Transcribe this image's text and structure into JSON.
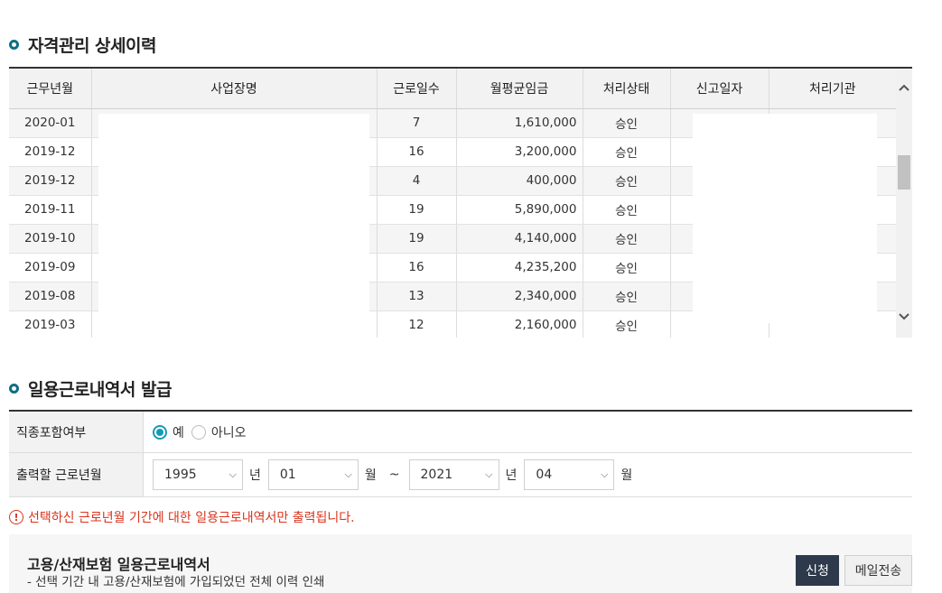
{
  "history": {
    "title": "자격관리 상세이력",
    "columns": [
      "근무년월",
      "사업장명",
      "근로일수",
      "월평균임금",
      "처리상태",
      "신고일자",
      "처리기관"
    ],
    "rows": [
      {
        "ym": "2020-01",
        "days": "7",
        "wage": "1,610,000",
        "status": "승인"
      },
      {
        "ym": "2019-12",
        "days": "16",
        "wage": "3,200,000",
        "status": "승인"
      },
      {
        "ym": "2019-12",
        "days": "4",
        "wage": "400,000",
        "status": "승인"
      },
      {
        "ym": "2019-11",
        "days": "19",
        "wage": "5,890,000",
        "status": "승인"
      },
      {
        "ym": "2019-10",
        "days": "19",
        "wage": "4,140,000",
        "status": "승인"
      },
      {
        "ym": "2019-09",
        "days": "16",
        "wage": "4,235,200",
        "status": "승인"
      },
      {
        "ym": "2019-08",
        "days": "13",
        "wage": "2,340,000",
        "status": "승인"
      },
      {
        "ym": "2019-03",
        "days": "12",
        "wage": "2,160,000",
        "status": "승인"
      }
    ]
  },
  "issue": {
    "title": "일용근로내역서 발급",
    "include_label": "직종포함여부",
    "option_yes": "예",
    "option_no": "아니오",
    "include_selected": "예",
    "period_label": "출력할 근로년월",
    "start_year": "1995",
    "start_month": "01",
    "end_year": "2021",
    "end_month": "04",
    "unit_year": "년",
    "unit_month": "월",
    "tilde": "~",
    "notice": "선택하신 근로년월 기간에 대한 일용근로내역서만 출력됩니다.",
    "box_title": "고용/산재보험 일용근로내역서",
    "box_desc": "- 선택 기간 내 고용/산재보험에 가입되었던 전체 이력 인쇄",
    "apply_label": "신청",
    "mail_label": "메일전송"
  },
  "icons": {
    "section_bullet": "ring-bullet-icon",
    "scroll_up": "chevron-up-icon",
    "scroll_down": "chevron-down-icon",
    "select_arrow": "chevron-down-icon",
    "notice_icon": "exclamation-circle-icon"
  },
  "colors": {
    "accent": "#0f6f86",
    "radio": "#129cb4",
    "warning": "#d9341e",
    "apply_button": "#2e3a4b"
  }
}
